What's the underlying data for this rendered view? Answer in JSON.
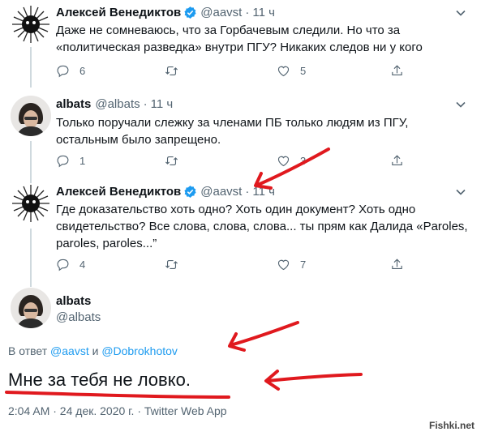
{
  "tweets": [
    {
      "name": "Алексей Венедиктов",
      "handle": "@aavst",
      "dot": "·",
      "time": "11 ч",
      "verified": true,
      "lines": [
        "Даже не сомневаюсь, что за Горбачевым следили. Но что за",
        "«политическая разведка» внутри ПГУ? Никаких следов ни у кого"
      ],
      "replies": "6",
      "retweets": "",
      "likes": "5"
    },
    {
      "name": "albats",
      "handle": "@albats",
      "dot": "·",
      "time": "11 ч",
      "verified": false,
      "lines": [
        "Только поручали слежку за членами ПБ только людям из ПГУ,",
        "остальным было запрещено."
      ],
      "replies": "1",
      "retweets": "",
      "likes": "3"
    },
    {
      "name": "Алексей Венедиктов",
      "handle": "@aavst",
      "dot": "·",
      "time": "11 ч",
      "verified": true,
      "lines": [
        "Где доказательство хоть одно? Хоть один документ? Хоть одно",
        "свидетельство? Все слова, слова, слова... ты прям как Далида «Paroles,",
        "paroles, paroles...”"
      ],
      "replies": "4",
      "retweets": "",
      "likes": "7"
    }
  ],
  "main_tweet": {
    "name": "albats",
    "handle": "@albats",
    "reply_prefix": "В ответ",
    "mention1": "@aavst",
    "reply_and": "и",
    "mention2": "@Dobrokhotov",
    "text": "Мне за тебя не ловко.",
    "meta": "2:04 AM · 24 дек. 2020 г. · Twitter Web App"
  },
  "watermark": "Fishki.net",
  "colors": {
    "accent": "#1d9bf0",
    "muted": "#536471",
    "annotation": "#e0191e"
  },
  "icons": [
    "reply-icon",
    "retweet-icon",
    "like-icon",
    "share-icon",
    "verified-icon",
    "caret-down-icon"
  ]
}
